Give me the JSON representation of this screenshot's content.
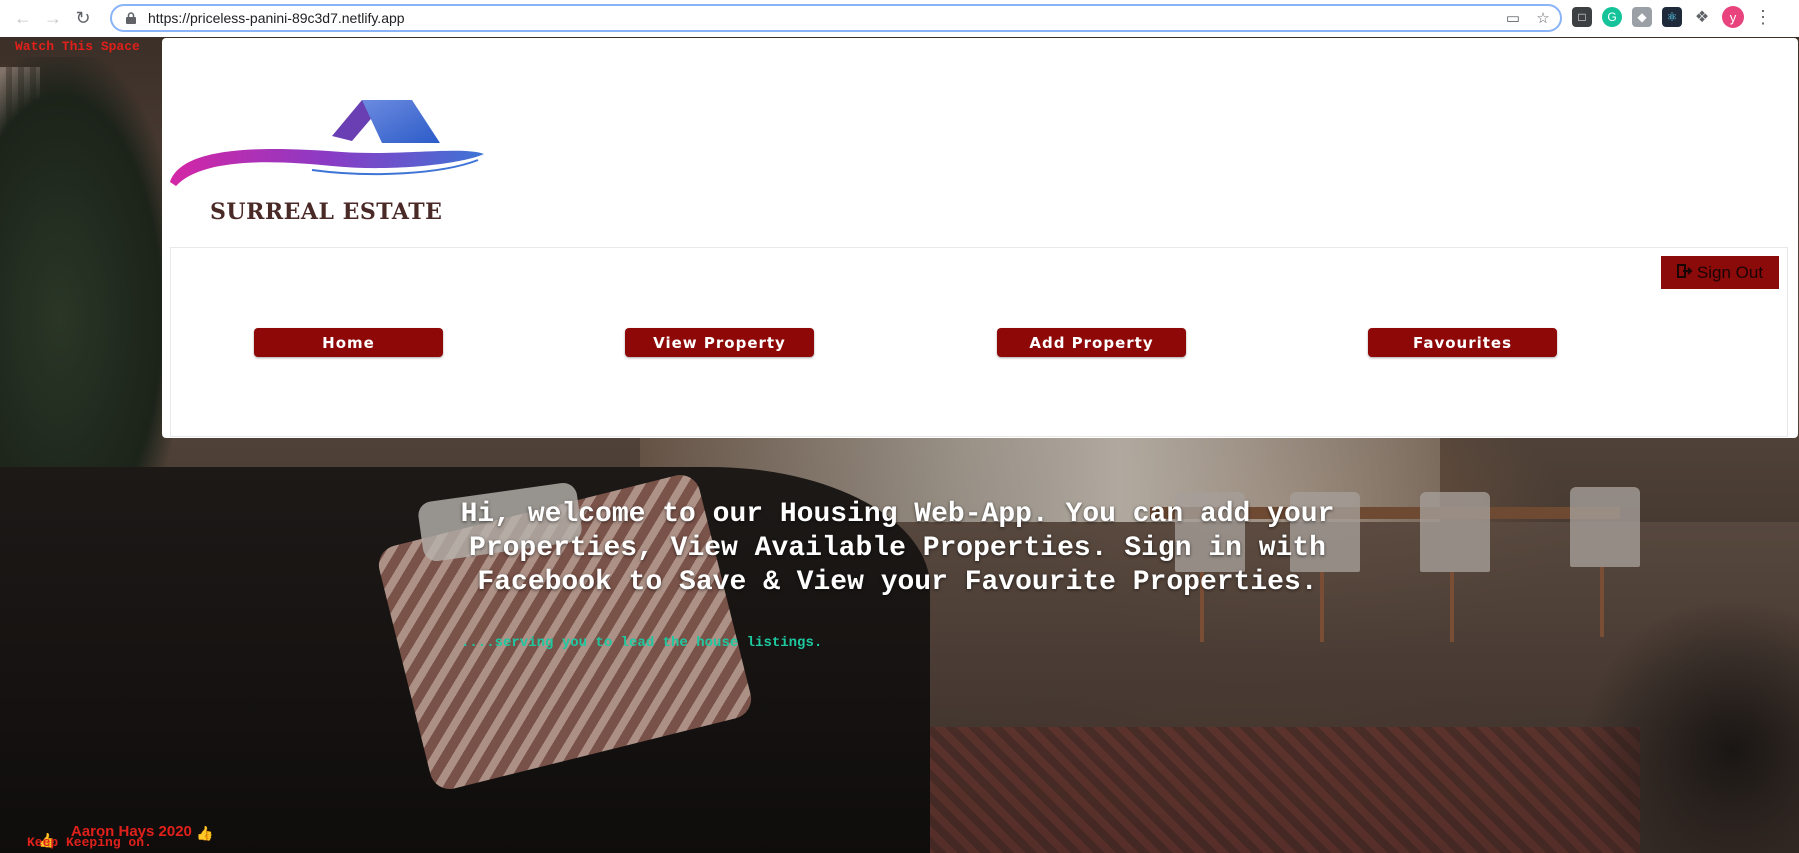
{
  "browser": {
    "url": "https://priceless-panini-89c3d7.netlify.app",
    "avatar_initial": "y"
  },
  "page": {
    "corner_text": "Watch This Space",
    "logo_text": "SURREAL ESTATE",
    "signout_label": "Sign Out",
    "nav": [
      {
        "label": "Home"
      },
      {
        "label": "View Property"
      },
      {
        "label": "Add Property"
      },
      {
        "label": "Favourites"
      }
    ],
    "welcome": "Hi, welcome to our Housing Web-App. You can add your Properties, View Available Properties. Sign in with Facebook to Save & View your Favourite Properties.",
    "tagline": "....serving you to lead the house listings.",
    "footer_name": "Aaron Hays 2020",
    "footer_sub": "Keep Keeping on."
  },
  "colors": {
    "accent_red": "#8f0808",
    "tagline_teal": "#1ec9a0"
  },
  "icons": [
    "back-arrow-icon",
    "forward-arrow-icon",
    "reload-icon",
    "lock-icon",
    "cast-icon",
    "star-icon",
    "puzzle-icon",
    "signout-icon",
    "thumbs-up-icon"
  ]
}
